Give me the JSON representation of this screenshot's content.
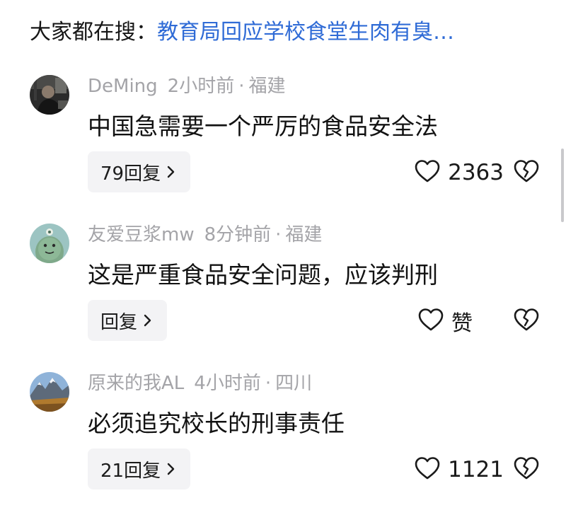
{
  "search": {
    "prefix": "大家都在搜：",
    "query": "教育局回应学校食堂生肉有臭…",
    "link_color": "#2f6bd6"
  },
  "comments": [
    {
      "username": "DeMing",
      "time": "2小时前",
      "separator": "·",
      "location": "福建",
      "text": "中国急需要一个严厉的食品安全法",
      "reply_label": "79回复",
      "like_count": "2363",
      "avatar_icon": "dark-photo-avatar"
    },
    {
      "username": "友爱豆浆mw",
      "time": "8分钟前",
      "separator": "·",
      "location": "福建",
      "text": "这是严重食品安全问题，应该判刑",
      "reply_label": "回复",
      "like_label": "赞",
      "avatar_icon": "green-cartoon-avatar"
    },
    {
      "username": "原来的我AL",
      "time": "4小时前",
      "separator": "·",
      "location": "四川",
      "text": "必须追究校长的刑事责任",
      "reply_label": "21回复",
      "like_count": "1121",
      "avatar_icon": "mountain-landscape-avatar"
    }
  ],
  "icons": {
    "like": "heart-outline-icon",
    "dislike": "broken-heart-icon",
    "reply_arrow": "chevron-right-icon"
  },
  "colors": {
    "meta_text": "#a4a4a8",
    "reply_bg": "#f3f3f5"
  }
}
